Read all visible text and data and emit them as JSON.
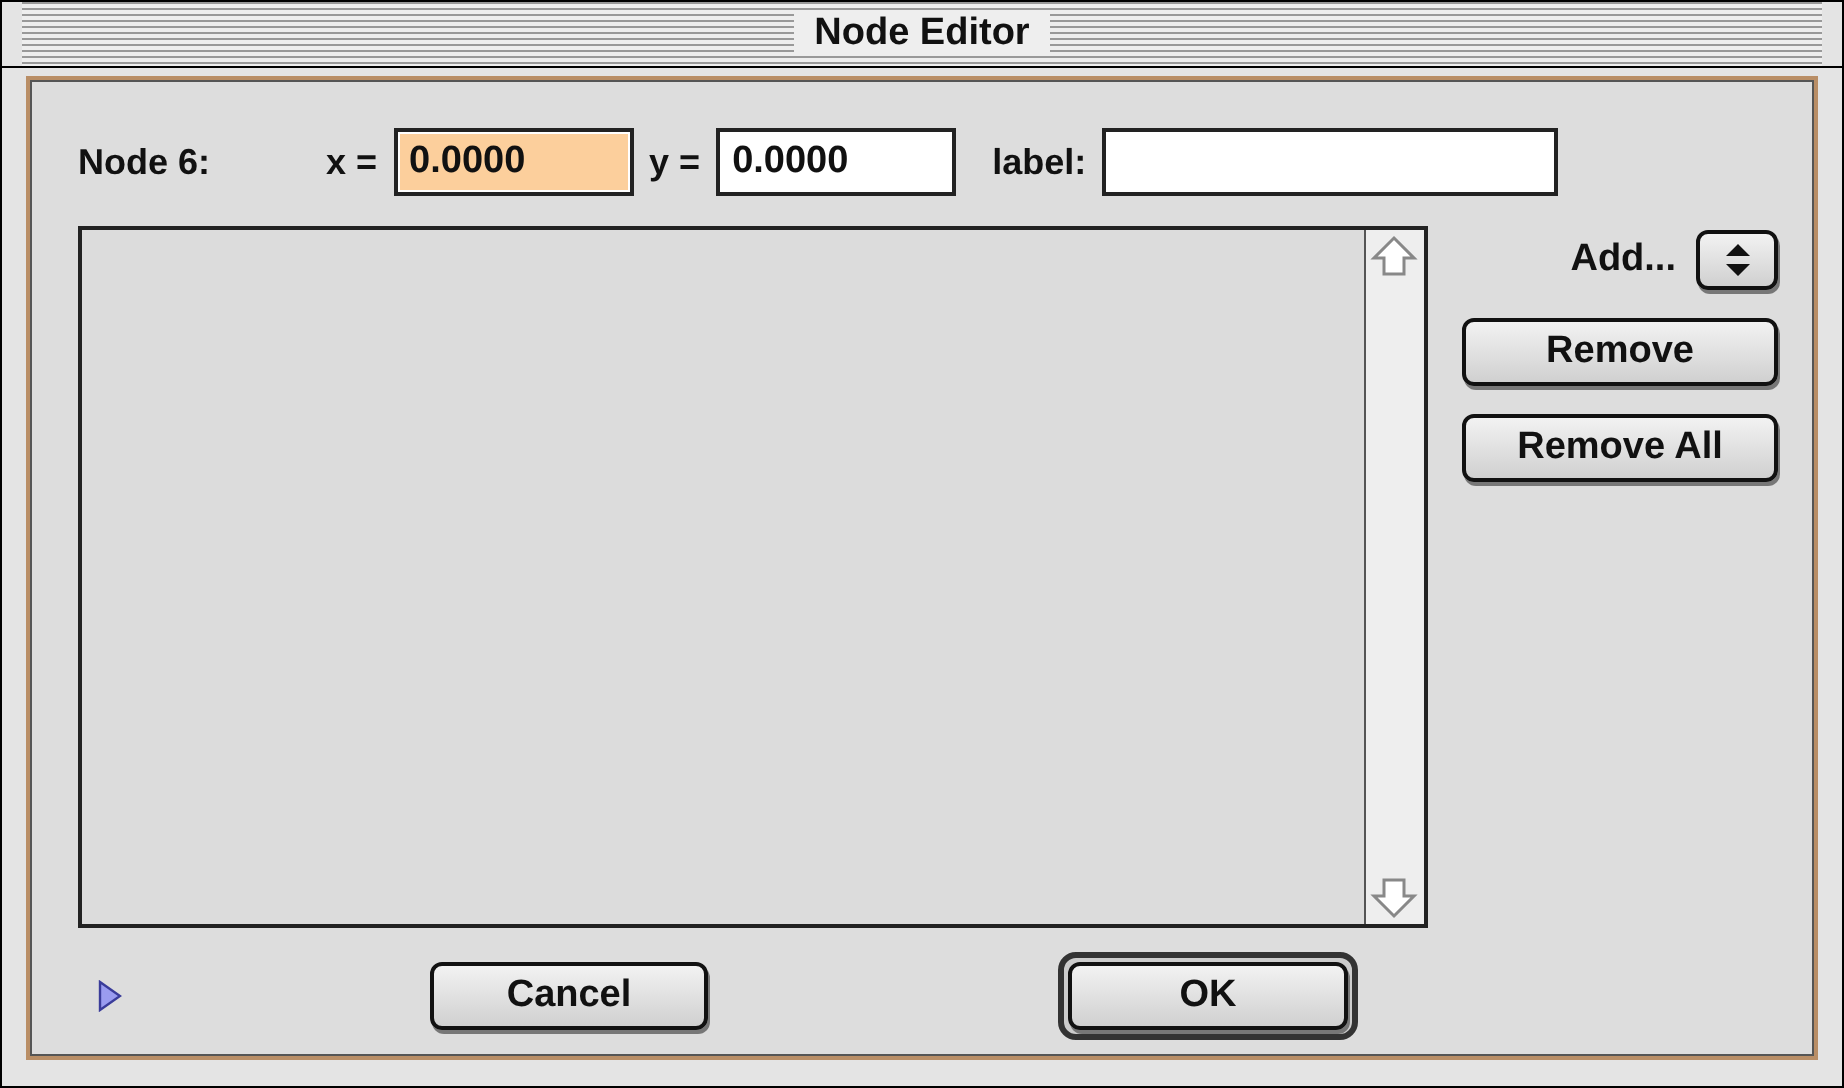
{
  "window": {
    "title": "Node Editor"
  },
  "node_label": "Node 6:",
  "fields": [
    {
      "label": "x =",
      "value": "0.0000",
      "selected": true
    },
    {
      "label": "y =",
      "value": "0.0000",
      "selected": false
    },
    {
      "label": "label:",
      "selected": false
    }
  ],
  "add_popup": {
    "label": "Add..."
  },
  "side_buttons": [
    "Remove",
    "Remove All"
  ],
  "disclosure": {
    "expanded": false
  },
  "buttons": [
    {
      "label": "Cancel",
      "default": false
    },
    {
      "label": "OK",
      "default": true
    }
  ]
}
